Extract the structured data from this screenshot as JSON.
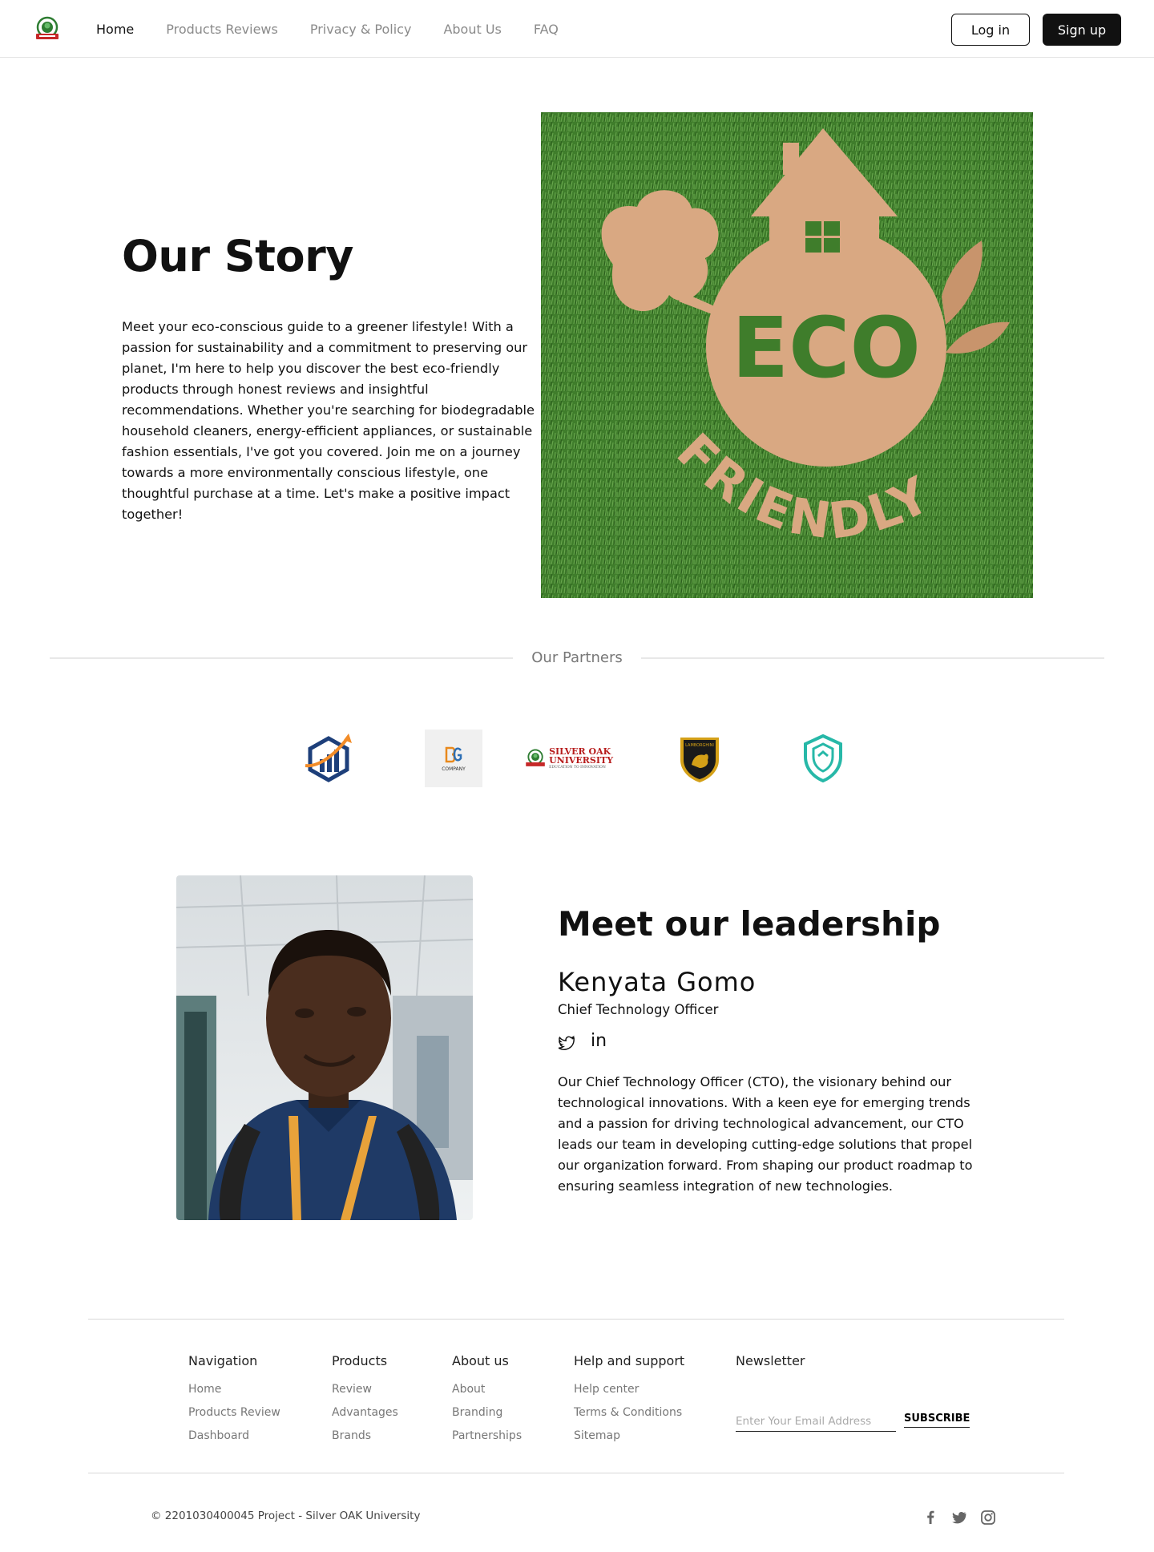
{
  "nav": {
    "items": [
      {
        "label": "Home",
        "active": true
      },
      {
        "label": "Products Reviews",
        "active": false
      },
      {
        "label": "Privacy & Policy",
        "active": false
      },
      {
        "label": "About Us",
        "active": false
      },
      {
        "label": "FAQ",
        "active": false
      }
    ],
    "login_label": "Log in",
    "signup_label": "Sign up"
  },
  "story": {
    "title": "Our Story",
    "text": "Meet your eco-conscious guide to a greener lifestyle! With a passion for sustainability and a commitment to preserving our planet, I'm here to help you discover the best eco-friendly products through honest reviews and insightful recommendations. Whether you're searching for biodegradable household cleaners, energy-efficient appliances, or sustainable fashion essentials, I've got you covered. Join me on a journey towards a more environmentally conscious lifestyle, one thoughtful purchase at a time. Let's make a positive impact together!",
    "image_text": "ECO",
    "image_text2": "FRIENDLY"
  },
  "partners": {
    "title": "Our Partners",
    "logos": [
      {
        "icon": "chart-arrow-logo-icon"
      },
      {
        "icon": "company-logo-icon",
        "text": "COMPANY"
      },
      {
        "icon": "silver-oak-university-logo-icon",
        "text": "SILVER OAK UNIVERSITY",
        "subtext": "EDUCATION TO INNOVATION"
      },
      {
        "icon": "lamborghini-logo-icon",
        "text": "LAMBORGHINI"
      },
      {
        "icon": "shield-logo-icon"
      }
    ]
  },
  "leadership": {
    "heading": "Meet our leadership",
    "name": "Kenyata Gomo",
    "role": "Chief Technology Officer",
    "linkedin_label": "in",
    "bio": "Our Chief Technology Officer (CTO), the visionary behind our technological innovations. With a keen eye for emerging trends and a passion for driving technological advancement, our CTO leads our team in developing cutting-edge solutions that propel our organization forward. From shaping our product roadmap to ensuring seamless integration of new technologies."
  },
  "footer": {
    "columns": [
      {
        "title": "Navigation",
        "links": [
          "Home",
          "Products Review",
          "Dashboard"
        ]
      },
      {
        "title": "Products",
        "links": [
          "Review",
          "Advantages",
          "Brands"
        ]
      },
      {
        "title": "About us",
        "links": [
          "About",
          "Branding",
          "Partnerships"
        ]
      },
      {
        "title": "Help and support",
        "links": [
          "Help center",
          "Terms & Conditions",
          "Sitemap"
        ]
      }
    ],
    "newsletter": {
      "title": "Newsletter",
      "placeholder": "Enter Your Email Address",
      "button": "SUBSCRIBE"
    },
    "copyright": "© 2201030400045 Project - Silver OAK University",
    "social_icons": [
      "facebook-icon",
      "twitter-icon",
      "instagram-icon"
    ]
  },
  "colors": {
    "accent": "#111111",
    "grass": "#3d7a2a",
    "cardboard": "#d9a882",
    "muted_text": "#8a8a8a"
  }
}
